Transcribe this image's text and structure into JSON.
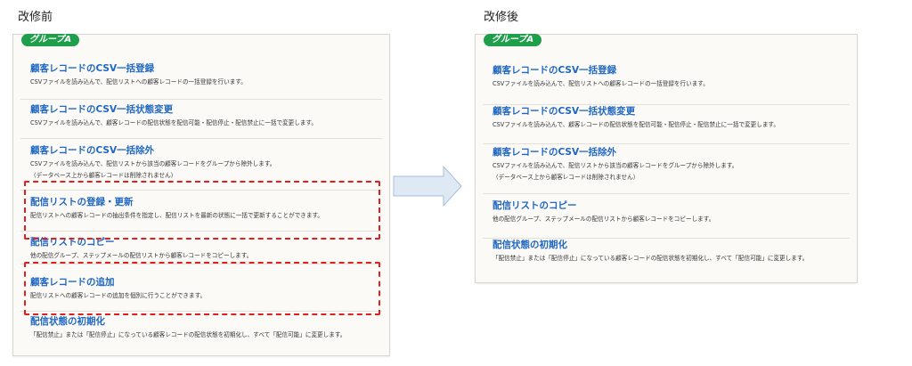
{
  "headings": {
    "before": "改修前",
    "after": "改修後"
  },
  "group_label": "グループA",
  "before_items": [
    {
      "title": "顧客レコードのCSV一括登録",
      "desc": [
        "CSVファイルを読み込んで、配信リストへの顧客レコードの一括登録を行います。"
      ]
    },
    {
      "title": "顧客レコードのCSV一括状態変更",
      "desc": [
        "CSVファイルを読み込んで、顧客レコードの配信状態を配信可能・配信停止・配信禁止に一括で変更します。"
      ]
    },
    {
      "title": "顧客レコードのCSV一括除外",
      "desc": [
        "CSVファイルを読み込んで、配信リストから該当の顧客レコードをグループから除外します。",
        "（データベース上から顧客レコードは削除されません）"
      ]
    },
    {
      "title": "配信リストの登録・更新",
      "desc": [
        "配信リストへの顧客レコードの抽出条件を指定し、配信リストを最新の状態に一括で更新することができます。"
      ]
    },
    {
      "title": "配信リストのコピー",
      "desc": [
        "他の配信グループ、ステップメールの配信リストから顧客レコードをコピーします。"
      ]
    },
    {
      "title": "顧客レコードの追加",
      "desc": [
        "配信リストへの顧客レコードの追加を個別に行うことができます。"
      ]
    },
    {
      "title": "配信状態の初期化",
      "desc": [
        "「配信禁止」または「配信停止」になっている顧客レコードの配信状態を初期化し、すべて「配信可能」に変更します。"
      ]
    }
  ],
  "after_items": [
    {
      "title": "顧客レコードのCSV一括登録",
      "desc": [
        "CSVファイルを読み込んで、配信リストへの顧客レコードの一括登録を行います。"
      ]
    },
    {
      "title": "顧客レコードのCSV一括状態変更",
      "desc": [
        "CSVファイルを読み込んで、顧客レコードの配信状態を配信可能・配信停止・配信禁止に一括で変更します。"
      ]
    },
    {
      "title": "顧客レコードのCSV一括除外",
      "desc": [
        "CSVファイルを読み込んで、配信リストから該当の顧客レコードをグループから除外します。",
        "（データベース上から顧客レコードは削除されません）"
      ]
    },
    {
      "title": "配信リストのコピー",
      "desc": [
        "他の配信グループ、ステップメールの配信リストから顧客レコードをコピーします。"
      ]
    },
    {
      "title": "配信状態の初期化",
      "desc": [
        "「配信禁止」または「配信停止」になっている顧客レコードの配信状態を初期化し、すべて「配信可能」に変更します。"
      ]
    }
  ],
  "colors": {
    "accent": "#1f67c2",
    "badge": "#1f9f4c",
    "highlight": "#e02020",
    "arrow": "#dfe9f4"
  }
}
